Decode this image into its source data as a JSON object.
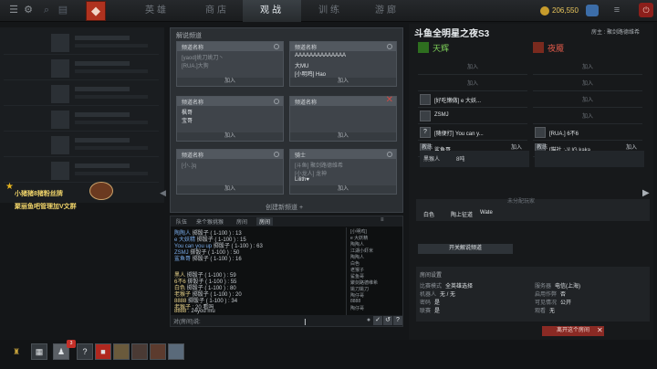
{
  "nav": {
    "tabs": [
      "英雄",
      "商店",
      "观战",
      "训练",
      "游廊"
    ],
    "active": "观战"
  },
  "topbar": {
    "gold": "206,550",
    "power_glyph": "⏻",
    "menu_glyph": "≡"
  },
  "channels": {
    "title": "解说频道",
    "cards": [
      {
        "header": "频道名称",
        "lines": [
          "[yaod]姚刀姚刀丶",
          "[RUA.]大狗"
        ],
        "join": "加入"
      },
      {
        "header": "频道名称",
        "lines": [
          "AAAAAAAAAAAAAA",
          "大MU",
          "[小明鸡] Hao"
        ],
        "join": "加入"
      },
      {
        "header": "频道名称",
        "lines": [
          "枫哥",
          "宝哥"
        ],
        "join": "加入"
      },
      {
        "header": "频道名称",
        "lines": [],
        "join": "加入"
      },
      {
        "header": "频道名称",
        "lines": [
          "[小..]q"
        ],
        "join": "加入"
      },
      {
        "header": "骑士",
        "lines": [
          "[斗鱼] 聚剑路德维希",
          "[小龙人] 龙神",
          "Lilith♥"
        ],
        "join": "加入"
      }
    ],
    "create_label": "创建新频道"
  },
  "chat": {
    "tabs": [
      "队伍",
      "来个猴挑猴",
      "房间",
      "房间"
    ],
    "active_tab": "房间",
    "lines": [
      {
        "name": "陶陶人",
        "msg": "掷骰子 ( 1-100 ) : 13"
      },
      {
        "name": "e 大妖精",
        "msg": "掷骰子 ( 1-100 ) : 15"
      },
      {
        "name": "You can you up",
        "msg": "掷骰子 ( 1-100 ) : 63"
      },
      {
        "name": "ZSMJ",
        "msg": "掷骰子 ( 1-100 ) : 50"
      },
      {
        "name": "鲨鱼哥",
        "msg": "掷骰子 ( 1-100 ) : 16"
      },
      {
        "name": "",
        "msg": ""
      },
      {
        "name": "黑人",
        "msg": "掷骰子 ( 1-100 ) : 59"
      },
      {
        "name": "6不6",
        "msg": "掷骰子 ( 1-100 ) : 55"
      },
      {
        "name": "白色",
        "msg": "掷骰子 ( 1-100 ) : 80"
      },
      {
        "name": "老猴子",
        "msg": "掷骰子 ( 1-100 ) : 20"
      },
      {
        "name": "8888",
        "msg": "掷骰子 ( 1-100 ) : 34"
      },
      {
        "name": "老猴子",
        "msg": ": 20 看吗"
      },
      {
        "name": "8888",
        "msg": ": 24you mu"
      }
    ],
    "users": [
      "[小明鸡]",
      "e 大妖精",
      "陶陶人",
      "江湖小虾米",
      "陶陶人",
      "白色",
      "老猴子",
      "鲨鱼哥",
      "聚剑路德维希",
      "姚刀姚刀",
      "陶仔哥",
      "8888",
      "陶仔哥"
    ],
    "input_placeholder": "对(房间)说:",
    "btn_ok": "✓",
    "btn_back": "↺",
    "btn_more": "?"
  },
  "lobby": {
    "title": "斗鱼全明星之夜S3",
    "host": "房主 : 聚剑路德维希",
    "radiant": {
      "name": "天辉",
      "color": "#7fd35a",
      "slots": [
        {
          "join": "加入",
          "name": ""
        },
        {
          "join": "加入",
          "name": ""
        },
        {
          "join": "",
          "name": "[好吃懒做] e 大妖..."
        },
        {
          "join": "",
          "name": "ZSMJ"
        },
        {
          "join": "",
          "name": "[随便打] You can y..."
        },
        {
          "join": "",
          "name": "鲨鱼哥"
        }
      ]
    },
    "dire": {
      "name": "夜魇",
      "color": "#e25a4a",
      "slots": [
        {
          "join": "加入",
          "name": ""
        },
        {
          "join": "加入",
          "name": ""
        },
        {
          "join": "加入",
          "name": ""
        },
        {
          "join": "加入",
          "name": ""
        },
        {
          "join": "",
          "name": "[RUA.] 6不6"
        },
        {
          "join": "",
          "name": "[猫社 :-)] IG.kaka"
        }
      ]
    },
    "coach_label": "教练",
    "coach_join": "加入",
    "radiant_coach_box": "黑猴人",
    "radiant_coach_box2": "8吨",
    "unassigned_title": "未分配玩家",
    "unassigned": [
      "白色",
      "陶上征道",
      "Wate"
    ],
    "broadcast_button": "开关解说频道",
    "settings_title": "房间设置",
    "settings": [
      {
        "k": "比赛模式",
        "v": "全英雄选择"
      },
      {
        "k": "服务器",
        "v": "电信(上海)"
      },
      {
        "k": "机器人",
        "v": "无 / 无"
      },
      {
        "k": "启用作弊",
        "v": "否"
      },
      {
        "k": "密码",
        "v": "是"
      },
      {
        "k": "可见情况",
        "v": "公开"
      },
      {
        "k": "联赛",
        "v": "是"
      },
      {
        "k": "观看",
        "v": "无"
      }
    ],
    "leave_button": "离开这个房间",
    "leave_x": "✕"
  },
  "promo": {
    "line1": "小猪猪8猪粉丝牌",
    "line2": "聚丽鱼吧管理加V文群",
    "star": "★"
  },
  "bottombar": {
    "notif": "3",
    "icons": [
      "arena-icon",
      "lobby-icon",
      "help-icon",
      "gift-icon",
      "avatar-1",
      "avatar-2",
      "avatar-3",
      "avatar-4"
    ]
  }
}
